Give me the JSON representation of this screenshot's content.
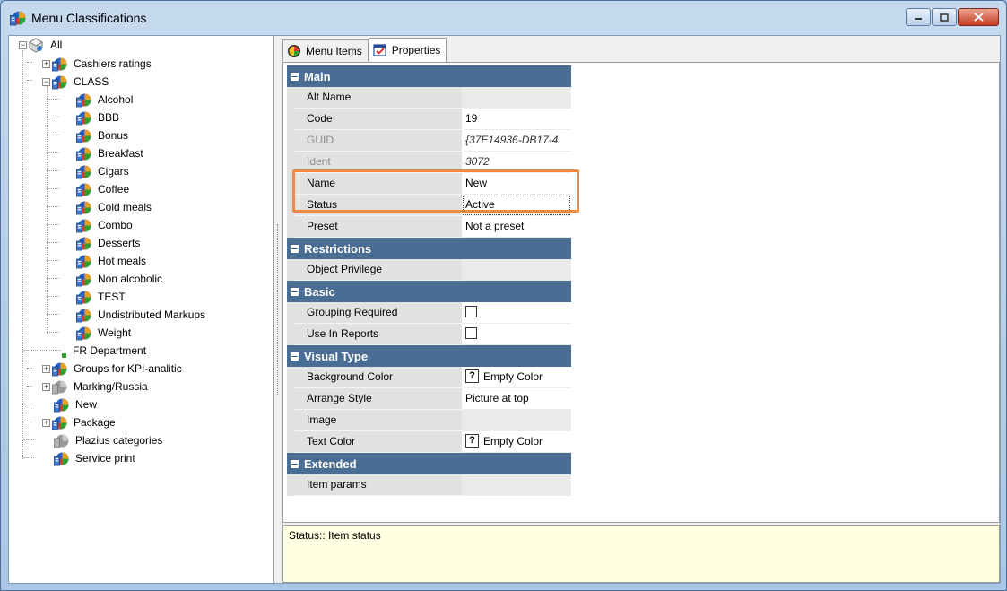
{
  "window": {
    "title": "Menu Classifications",
    "minimize_icon": "minimize-icon",
    "maximize_icon": "maximize-icon",
    "close_icon": "close-icon"
  },
  "tree": {
    "root": "All",
    "items": [
      {
        "label": "Cashiers ratings",
        "icon": "classification-icon"
      },
      {
        "label": "CLASS",
        "icon": "classification-icon"
      },
      {
        "label": "Alcohol",
        "icon": "classification-icon"
      },
      {
        "label": "BBB",
        "icon": "classification-icon"
      },
      {
        "label": "Bonus",
        "icon": "classification-icon"
      },
      {
        "label": "Breakfast",
        "icon": "classification-icon"
      },
      {
        "label": "Cigars",
        "icon": "classification-icon"
      },
      {
        "label": "Coffee",
        "icon": "classification-icon"
      },
      {
        "label": "Cold meals",
        "icon": "classification-icon"
      },
      {
        "label": "Combo",
        "icon": "classification-icon"
      },
      {
        "label": "Desserts",
        "icon": "classification-icon"
      },
      {
        "label": "Hot meals",
        "icon": "classification-icon"
      },
      {
        "label": "Non alcoholic",
        "icon": "classification-icon"
      },
      {
        "label": "TEST",
        "icon": "classification-icon"
      },
      {
        "label": "Undistributed Markups",
        "icon": "classification-icon"
      },
      {
        "label": "Weight",
        "icon": "classification-icon"
      },
      {
        "label": "FR Department",
        "icon": "small-green-square-icon"
      },
      {
        "label": "Groups for KPI-analitic",
        "icon": "classification-icon"
      },
      {
        "label": "Marking/Russia",
        "icon": "gray-classification-icon"
      },
      {
        "label": "New",
        "icon": "classification-icon"
      },
      {
        "label": "Package",
        "icon": "classification-icon"
      },
      {
        "label": "Plazius categories",
        "icon": "gray-classification-icon"
      },
      {
        "label": "Service print",
        "icon": "classification-icon"
      }
    ]
  },
  "tabs": [
    {
      "label": "Menu Items",
      "icon": "menu-items-icon"
    },
    {
      "label": "Properties",
      "icon": "properties-icon"
    }
  ],
  "properties": {
    "main": {
      "title": "Main",
      "alt_name": {
        "label": "Alt Name",
        "value": ""
      },
      "code": {
        "label": "Code",
        "value": "19"
      },
      "guid": {
        "label": "GUID",
        "value": "{37E14936-DB17-4"
      },
      "ident": {
        "label": "Ident",
        "value": "3072"
      },
      "name": {
        "label": "Name",
        "value": "New"
      },
      "status": {
        "label": "Status",
        "value": "Active"
      },
      "preset": {
        "label": "Preset",
        "value": "Not a preset"
      }
    },
    "restrictions": {
      "title": "Restrictions",
      "object_privilege": {
        "label": "Object Privilege",
        "value": ""
      }
    },
    "basic": {
      "title": "Basic",
      "grouping_required": {
        "label": "Grouping Required",
        "checked": false
      },
      "use_in_reports": {
        "label": "Use In Reports",
        "checked": false
      }
    },
    "visual_type": {
      "title": "Visual Type",
      "background_color": {
        "label": "Background Color",
        "value": "Empty Color",
        "mark": "?"
      },
      "arrange_style": {
        "label": "Arrange Style",
        "value": "Picture at top"
      },
      "image": {
        "label": "Image",
        "value": ""
      },
      "text_color": {
        "label": "Text Color",
        "value": "Empty Color",
        "mark": "?"
      }
    },
    "extended": {
      "title": "Extended",
      "item_params": {
        "label": "Item params",
        "value": ""
      }
    }
  },
  "description": {
    "text": "Status:: Item status"
  },
  "colors": {
    "category_header": "#4a6d93",
    "highlight": "#ee8a40",
    "description_bg": "#ffffe1"
  }
}
